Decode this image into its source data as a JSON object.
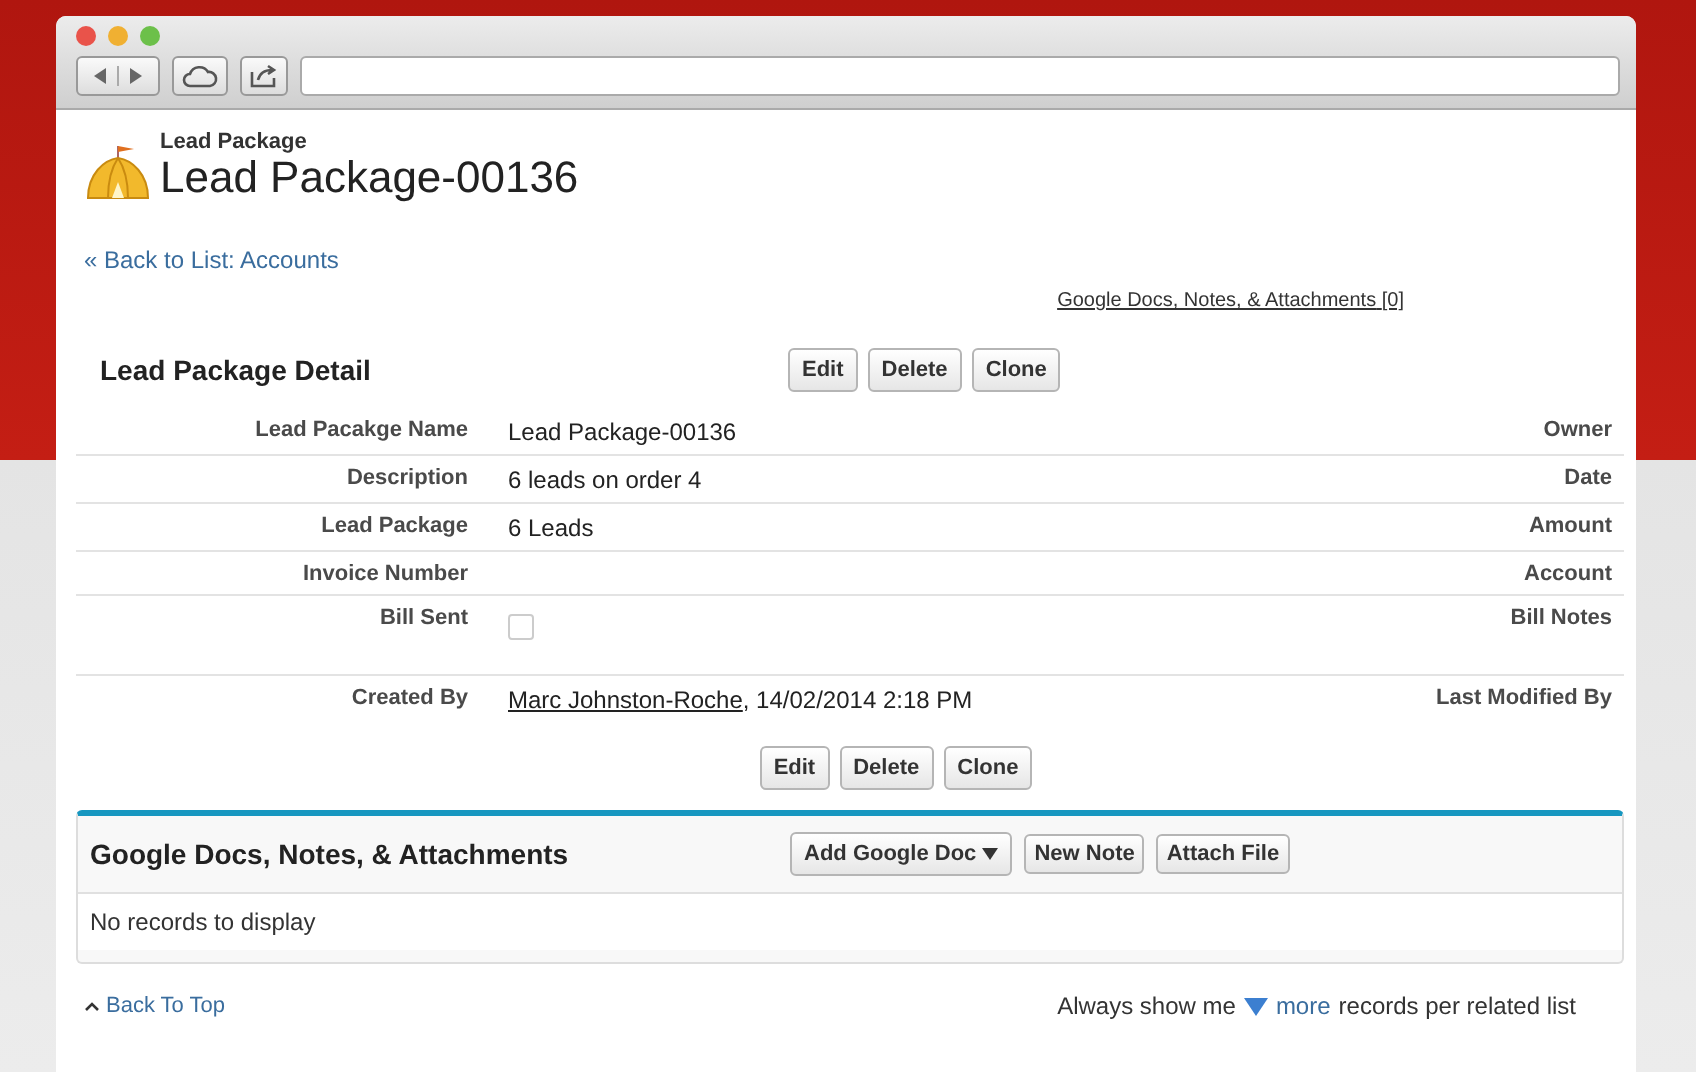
{
  "page_header": {
    "type_label": "Lead Package",
    "title": "Lead Package-00136"
  },
  "back_link": "« Back to List: Accounts",
  "related_link": {
    "label": "Google Docs, Notes, & Attachments",
    "count": "[0]"
  },
  "detail": {
    "title": "Lead Package Detail",
    "buttons": [
      "Edit",
      "Delete",
      "Clone"
    ],
    "rows": [
      {
        "label": "Lead Pacakge Name",
        "kind": "text",
        "value": "Lead Package-00136",
        "right_label": "Owner"
      },
      {
        "label": "Description",
        "kind": "text",
        "value": "6 leads on order 4",
        "right_label": "Date"
      },
      {
        "label": "Lead Package",
        "kind": "text",
        "value": "6 Leads",
        "right_label": "Amount"
      },
      {
        "label": "Invoice Number",
        "kind": "text",
        "right_label": "Account"
      },
      {
        "label": "Bill Sent",
        "kind": "checkbox",
        "checked": false,
        "right_label": "Bill Notes"
      },
      {
        "label": "Created By",
        "kind": "user",
        "link": "Marc Johnston-Roche",
        "value": ", 14/02/2014 2:18 PM",
        "right_label": "Last Modified By"
      }
    ],
    "bottom_buttons": [
      "Edit",
      "Delete",
      "Clone"
    ]
  },
  "related_list": {
    "title": "Google Docs, Notes, & Attachments",
    "dropdown": "Add Google Doc",
    "buttons": [
      "New Note",
      "Attach File"
    ],
    "empty_text": "No records to display"
  },
  "footer": {
    "back_to_top": "Back To Top",
    "prefix": "Always show me",
    "more": "more",
    "suffix": "records per related list"
  }
}
